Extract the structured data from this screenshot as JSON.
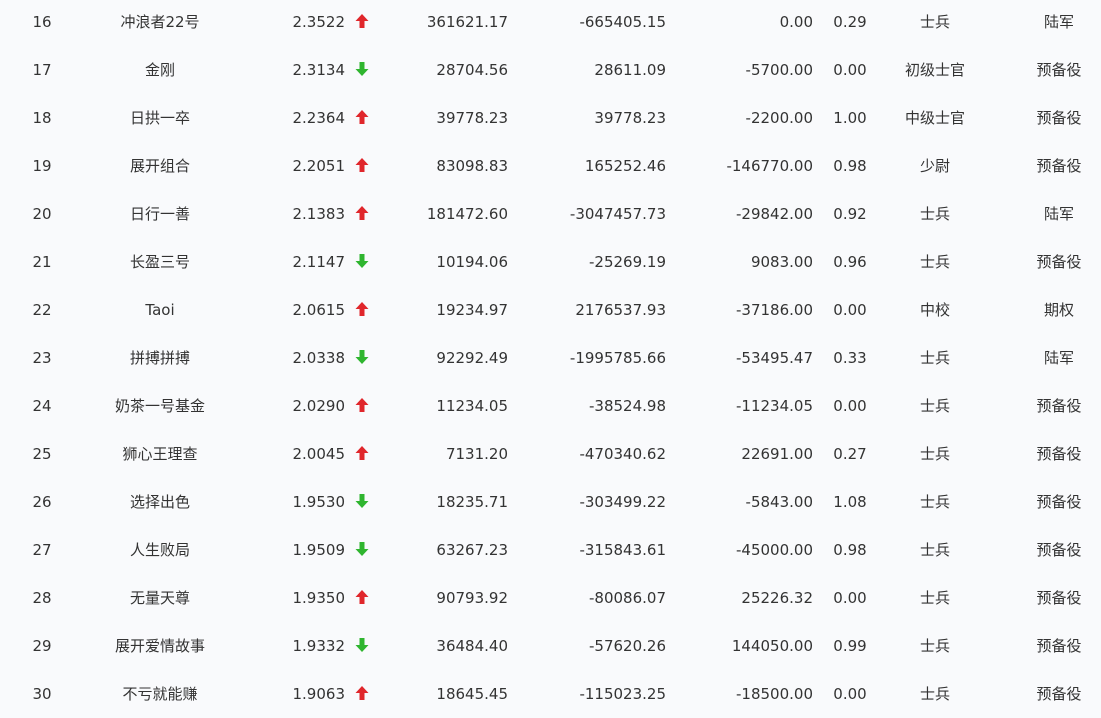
{
  "colors": {
    "background": "#f9fafc",
    "text": "#333333",
    "up_arrow": "#e0262b",
    "down_arrow": "#2fb52f"
  },
  "icons": {
    "up": "arrow-up-icon",
    "down": "arrow-down-icon"
  },
  "rows": [
    {
      "rank": "16",
      "name": "冲浪者22号",
      "score": "2.3522",
      "trend": "up",
      "v1": "361621.17",
      "v2": "-665405.15",
      "v3": "0.00",
      "ratio": "0.29",
      "level": "士兵",
      "type": "陆军"
    },
    {
      "rank": "17",
      "name": "金刚",
      "score": "2.3134",
      "trend": "down",
      "v1": "28704.56",
      "v2": "28611.09",
      "v3": "-5700.00",
      "ratio": "0.00",
      "level": "初级士官",
      "type": "预备役"
    },
    {
      "rank": "18",
      "name": "日拱一卒",
      "score": "2.2364",
      "trend": "up",
      "v1": "39778.23",
      "v2": "39778.23",
      "v3": "-2200.00",
      "ratio": "1.00",
      "level": "中级士官",
      "type": "预备役"
    },
    {
      "rank": "19",
      "name": "展开组合",
      "score": "2.2051",
      "trend": "up",
      "v1": "83098.83",
      "v2": "165252.46",
      "v3": "-146770.00",
      "ratio": "0.98",
      "level": "少尉",
      "type": "预备役"
    },
    {
      "rank": "20",
      "name": "日行一善",
      "score": "2.1383",
      "trend": "up",
      "v1": "181472.60",
      "v2": "-3047457.73",
      "v3": "-29842.00",
      "ratio": "0.92",
      "level": "士兵",
      "type": "陆军"
    },
    {
      "rank": "21",
      "name": "长盈三号",
      "score": "2.1147",
      "trend": "down",
      "v1": "10194.06",
      "v2": "-25269.19",
      "v3": "9083.00",
      "ratio": "0.96",
      "level": "士兵",
      "type": "预备役"
    },
    {
      "rank": "22",
      "name": "Taoi",
      "score": "2.0615",
      "trend": "up",
      "v1": "19234.97",
      "v2": "2176537.93",
      "v3": "-37186.00",
      "ratio": "0.00",
      "level": "中校",
      "type": "期权"
    },
    {
      "rank": "23",
      "name": "拼搏拼搏",
      "score": "2.0338",
      "trend": "down",
      "v1": "92292.49",
      "v2": "-1995785.66",
      "v3": "-53495.47",
      "ratio": "0.33",
      "level": "士兵",
      "type": "陆军"
    },
    {
      "rank": "24",
      "name": "奶茶一号基金",
      "score": "2.0290",
      "trend": "up",
      "v1": "11234.05",
      "v2": "-38524.98",
      "v3": "-11234.05",
      "ratio": "0.00",
      "level": "士兵",
      "type": "预备役"
    },
    {
      "rank": "25",
      "name": "狮心王理查",
      "score": "2.0045",
      "trend": "up",
      "v1": "7131.20",
      "v2": "-470340.62",
      "v3": "22691.00",
      "ratio": "0.27",
      "level": "士兵",
      "type": "预备役"
    },
    {
      "rank": "26",
      "name": "选择出色",
      "score": "1.9530",
      "trend": "down",
      "v1": "18235.71",
      "v2": "-303499.22",
      "v3": "-5843.00",
      "ratio": "1.08",
      "level": "士兵",
      "type": "预备役"
    },
    {
      "rank": "27",
      "name": "人生败局",
      "score": "1.9509",
      "trend": "down",
      "v1": "63267.23",
      "v2": "-315843.61",
      "v3": "-45000.00",
      "ratio": "0.98",
      "level": "士兵",
      "type": "预备役"
    },
    {
      "rank": "28",
      "name": "无量天尊",
      "score": "1.9350",
      "trend": "up",
      "v1": "90793.92",
      "v2": "-80086.07",
      "v3": "25226.32",
      "ratio": "0.00",
      "level": "士兵",
      "type": "预备役"
    },
    {
      "rank": "29",
      "name": "展开爱情故事",
      "score": "1.9332",
      "trend": "down",
      "v1": "36484.40",
      "v2": "-57620.26",
      "v3": "144050.00",
      "ratio": "0.99",
      "level": "士兵",
      "type": "预备役"
    },
    {
      "rank": "30",
      "name": "不亏就能赚",
      "score": "1.9063",
      "trend": "up",
      "v1": "18645.45",
      "v2": "-115023.25",
      "v3": "-18500.00",
      "ratio": "0.00",
      "level": "士兵",
      "type": "预备役"
    }
  ]
}
